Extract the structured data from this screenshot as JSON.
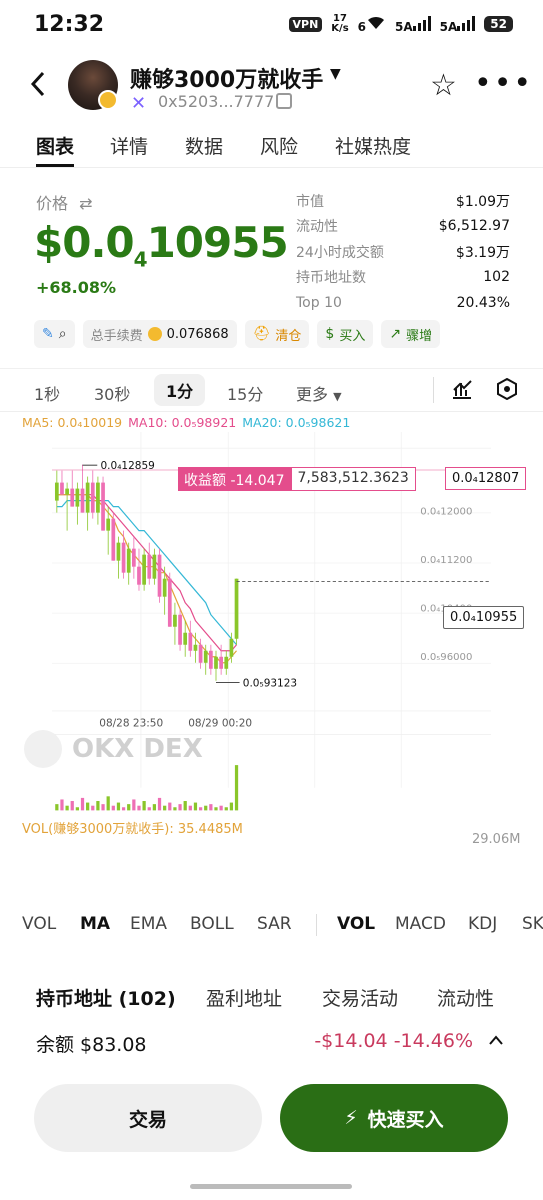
{
  "status_bar": {
    "time": "12:32",
    "vpn": "VPN",
    "speed_top": "17",
    "speed_bottom": "K/s",
    "wifi_label": "6",
    "sig1_label": "5A",
    "sig2_label": "5A",
    "battery": "52"
  },
  "header": {
    "token_name": "赚够3000万就收手",
    "address": "0x5203...7777"
  },
  "tabs": [
    "图表",
    "详情",
    "数据",
    "风险",
    "社媒热度"
  ],
  "price": {
    "label": "价格",
    "swap_icon": "⇄",
    "value_prefix": "$0.0",
    "value_sub": "4",
    "value_rest": "10955",
    "change": "+68.08%"
  },
  "stats": [
    {
      "k": "市值",
      "v": "$1.09万"
    },
    {
      "k": "流动性",
      "v": "$6,512.97"
    },
    {
      "k": "24小时成交额",
      "v": "$3.19万"
    },
    {
      "k": "持币地址数",
      "v": "102"
    },
    {
      "k": "Top 10",
      "v": "20.43%"
    }
  ],
  "chips": {
    "fee_label": "总手续费",
    "fee_value": "0.076868",
    "clear": "清仓",
    "buy": "买入",
    "surge": "骤增"
  },
  "intervals": [
    "1秒",
    "30秒",
    "1分",
    "15分",
    "更多"
  ],
  "ma_legend": {
    "ma5": "MA5: 0.0₄10019",
    "ma10": "MA10: 0.0₅98921",
    "ma20": "MA20: 0.0₅98621",
    "colors": {
      "ma5": "#e2a33a",
      "ma10": "#e44d8c",
      "ma20": "#35b8d6"
    }
  },
  "chart": {
    "high_label": "0.0₄12859",
    "low_label": "0.0₅93123",
    "pnl_left": "收益额 -14.047",
    "pnl_right": "7,583,512.3623",
    "pnl_price": "0.0₄12807",
    "current_price": "0.0₄10955",
    "y_ticks": [
      "0.0₄12000",
      "0.0₄11200",
      "0.0₄10400",
      "0.0₅96000"
    ],
    "x_ticks": [
      "08/28 23:50",
      "08/29 00:20"
    ],
    "watermark": "OKX DEX",
    "vol_label": "VOL(赚够3000万就收手): 35.4485M",
    "vol_max": "29.06M"
  },
  "chart_data": {
    "type": "candlestick",
    "x_ticks": [
      "08/28 23:50",
      "08/29 00:20"
    ],
    "y_ticks": [
      "0.0₄12000",
      "0.0₄11200",
      "0.0₄10400",
      "0.0₅96000"
    ],
    "high": "0.0₄12859",
    "low": "0.0₅93123",
    "current": "0.0₄10955",
    "colors": {
      "up": "#8ac62a",
      "down": "#ee6fb4"
    },
    "candles": [
      {
        "o": 1.23e-05,
        "h": 1.28e-05,
        "l": 1.21e-05,
        "c": 1.26e-05
      },
      {
        "o": 1.26e-05,
        "h": 1.28e-05,
        "l": 1.24e-05,
        "c": 1.24e-05
      },
      {
        "o": 1.24e-05,
        "h": 1.26e-05,
        "l": 1.18e-05,
        "c": 1.25e-05
      },
      {
        "o": 1.25e-05,
        "h": 1.28e-05,
        "l": 1.22e-05,
        "c": 1.22e-05
      },
      {
        "o": 1.22e-05,
        "h": 1.26e-05,
        "l": 1.19e-05,
        "c": 1.25e-05
      },
      {
        "o": 1.25e-05,
        "h": 1.29e-05,
        "l": 1.21e-05,
        "c": 1.21e-05
      },
      {
        "o": 1.21e-05,
        "h": 1.27e-05,
        "l": 1.18e-05,
        "c": 1.26e-05
      },
      {
        "o": 1.26e-05,
        "h": 1.28e-05,
        "l": 1.2e-05,
        "c": 1.21e-05
      },
      {
        "o": 1.21e-05,
        "h": 1.27e-05,
        "l": 1.19e-05,
        "c": 1.26e-05
      },
      {
        "o": 1.26e-05,
        "h": 1.27e-05,
        "l": 1.18e-05,
        "c": 1.18e-05
      },
      {
        "o": 1.18e-05,
        "h": 1.22e-05,
        "l": 1.14e-05,
        "c": 1.2e-05
      },
      {
        "o": 1.2e-05,
        "h": 1.21e-05,
        "l": 1.13e-05,
        "c": 1.13e-05
      },
      {
        "o": 1.13e-05,
        "h": 1.17e-05,
        "l": 1.1e-05,
        "c": 1.16e-05
      },
      {
        "o": 1.16e-05,
        "h": 1.18e-05,
        "l": 1.1e-05,
        "c": 1.11e-05
      },
      {
        "o": 1.11e-05,
        "h": 1.16e-05,
        "l": 1.09e-05,
        "c": 1.15e-05
      },
      {
        "o": 1.15e-05,
        "h": 1.17e-05,
        "l": 1.1e-05,
        "c": 1.12e-05
      },
      {
        "o": 1.12e-05,
        "h": 1.15e-05,
        "l": 1.08e-05,
        "c": 1.09e-05
      },
      {
        "o": 1.09e-05,
        "h": 1.15e-05,
        "l": 1.08e-05,
        "c": 1.14e-05
      },
      {
        "o": 1.14e-05,
        "h": 1.16e-05,
        "l": 1.09e-05,
        "c": 1.1e-05
      },
      {
        "o": 1.1e-05,
        "h": 1.15e-05,
        "l": 1.09e-05,
        "c": 1.14e-05
      },
      {
        "o": 1.14e-05,
        "h": 1.15e-05,
        "l": 1.06e-05,
        "c": 1.07e-05
      },
      {
        "o": 1.07e-05,
        "h": 1.12e-05,
        "l": 1.04e-05,
        "c": 1.1e-05
      },
      {
        "o": 1.1e-05,
        "h": 1.11e-05,
        "l": 1.02e-05,
        "c": 1.02e-05
      },
      {
        "o": 1.02e-05,
        "h": 1.06e-05,
        "l": 9.9e-06,
        "c": 1.04e-05
      },
      {
        "o": 1.04e-05,
        "h": 1.05e-05,
        "l": 9.8e-06,
        "c": 9.9e-06
      },
      {
        "o": 9.9e-06,
        "h": 1.03e-05,
        "l": 9.7e-06,
        "c": 1.01e-05
      },
      {
        "o": 1.01e-05,
        "h": 1.03e-05,
        "l": 9.7e-06,
        "c": 9.8e-06
      },
      {
        "o": 9.8e-06,
        "h": 1.01e-05,
        "l": 9.6e-06,
        "c": 9.9e-06
      },
      {
        "o": 9.9e-06,
        "h": 1e-05,
        "l": 9.5e-06,
        "c": 9.6e-06
      },
      {
        "o": 9.6e-06,
        "h": 9.9e-06,
        "l": 9.4e-06,
        "c": 9.8e-06
      },
      {
        "o": 9.8e-06,
        "h": 9.9e-06,
        "l": 9.4e-06,
        "c": 9.5e-06
      },
      {
        "o": 9.5e-06,
        "h": 9.8e-06,
        "l": 9.3e-06,
        "c": 9.7e-06
      },
      {
        "o": 9.7e-06,
        "h": 9.9e-06,
        "l": 9.4e-06,
        "c": 9.5e-06
      },
      {
        "o": 9.5e-06,
        "h": 9.8e-06,
        "l": 9.4e-06,
        "c": 9.7e-06
      },
      {
        "o": 9.7e-06,
        "h": 1.01e-05,
        "l": 9.6e-06,
        "c": 1e-05
      },
      {
        "o": 1e-05,
        "h": 1.1e-05,
        "l": 9.9e-06,
        "c": 1.1e-05
      }
    ],
    "ma5": [
      1.24e-05,
      1.24e-05,
      1.24e-05,
      1.24e-05,
      1.24e-05,
      1.24e-05,
      1.24e-05,
      1.23e-05,
      1.23e-05,
      1.22e-05,
      1.21e-05,
      1.2e-05,
      1.18e-05,
      1.17e-05,
      1.15e-05,
      1.14e-05,
      1.13e-05,
      1.12e-05,
      1.12e-05,
      1.12e-05,
      1.11e-05,
      1.11e-05,
      1.09e-05,
      1.07e-05,
      1.05e-05,
      1.03e-05,
      1.01e-05,
      1e-05,
      9.9e-06,
      9.8e-06,
      9.7e-06,
      9.7e-06,
      9.6e-06,
      9.6e-06,
      9.7e-06,
      9.8e-06
    ],
    "ma10": [
      1.24e-05,
      1.24e-05,
      1.24e-05,
      1.24e-05,
      1.24e-05,
      1.24e-05,
      1.24e-05,
      1.24e-05,
      1.23e-05,
      1.23e-05,
      1.22e-05,
      1.21e-05,
      1.2e-05,
      1.19e-05,
      1.18e-05,
      1.17e-05,
      1.16e-05,
      1.15e-05,
      1.14e-05,
      1.13e-05,
      1.12e-05,
      1.11e-05,
      1.1e-05,
      1.09e-05,
      1.08e-05,
      1.06e-05,
      1.05e-05,
      1.03e-05,
      1.02e-05,
      1.01e-05,
      1e-05,
      9.9e-06,
      9.8e-06,
      9.8e-06,
      9.8e-06,
      9.9e-06
    ],
    "ma20": [
      1.22e-05,
      1.22e-05,
      1.23e-05,
      1.23e-05,
      1.23e-05,
      1.23e-05,
      1.23e-05,
      1.23e-05,
      1.23e-05,
      1.23e-05,
      1.23e-05,
      1.22e-05,
      1.22e-05,
      1.21e-05,
      1.2e-05,
      1.19e-05,
      1.18e-05,
      1.18e-05,
      1.17e-05,
      1.16e-05,
      1.15e-05,
      1.14e-05,
      1.13e-05,
      1.12e-05,
      1.11e-05,
      1.1e-05,
      1.09e-05,
      1.08e-05,
      1.07e-05,
      1.06e-05,
      1.04e-05,
      1.03e-05,
      1.02e-05,
      1.01e-05,
      1e-05,
      9.9e-06
    ],
    "volumes": [
      4,
      7,
      3,
      6,
      2,
      8,
      5,
      3,
      6,
      4,
      9,
      3,
      5,
      2,
      4,
      7,
      3,
      6,
      2,
      4,
      8,
      3,
      5,
      2,
      4,
      6,
      3,
      5,
      2,
      3,
      4,
      2,
      3,
      2,
      5,
      29
    ]
  },
  "indicators_left": [
    "VOL",
    "MA",
    "EMA",
    "BOLL",
    "SAR"
  ],
  "indicators_right": [
    "VOL",
    "MACD",
    "KDJ",
    "SKDJ"
  ],
  "holders": {
    "tabs": [
      "持币地址 (102)",
      "盈利地址",
      "交易活动",
      "流动性"
    ],
    "balance": "余额 $83.08",
    "pnl": "-$14.04 -14.46%"
  },
  "buttons": {
    "trade": "交易",
    "quick_buy": "快速买入"
  }
}
